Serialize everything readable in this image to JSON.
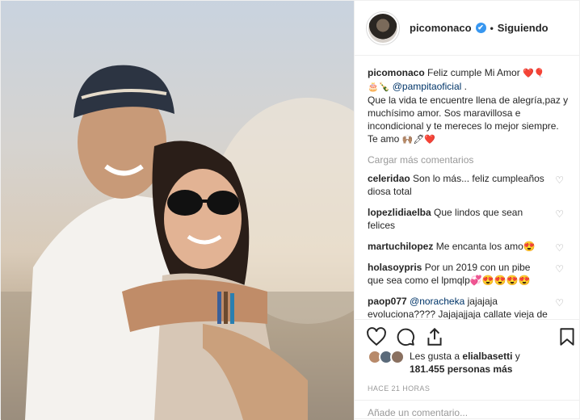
{
  "header": {
    "username": "picomonaco",
    "verified_mark": "✔",
    "separator": "•",
    "follow_label": "Siguiendo"
  },
  "caption": {
    "username": "picomonaco",
    "text_1": "Feliz cumple Mi Amor",
    "emoji_1": "❤️🎈",
    "emoji_2": "🎂🍾",
    "mention": "@pampitaoficial",
    "text_2": ".",
    "text_3": "Que la vida te encuentre llena de alegría,paz y muchísimo amor. Sos maravillosa e incondicional y te mereces lo mejor siempre. Te amo",
    "emoji_3": "🙌🏽🖊❤️"
  },
  "load_more": "Cargar más comentarios",
  "comments": [
    {
      "user": "celeridao",
      "text": "Son lo más... feliz cumpleaños diosa total"
    },
    {
      "user": "lopezlidiaelba",
      "text": "Que lindos que sean felices"
    },
    {
      "user": "martuchilopez",
      "text": "Me encanta los amo😍"
    },
    {
      "user": "holasoypris",
      "text": "Por un 2019 con un pibe que sea como el lpmqlp💞😍😍😍😍"
    },
    {
      "user": "paop077",
      "mention": "@noracheka",
      "text": "jajajaja evoluciona???? Jajajajjaja callate vieja de mierda"
    }
  ],
  "likes": {
    "prefix": "Les gusta a",
    "user": "elialbasetti",
    "joiner": "y",
    "count": "181.455 personas más"
  },
  "timestamp": "HACE 21 HORAS",
  "add_comment_placeholder": "Añade un comentario...",
  "colors": {
    "accent": "#3897f0",
    "mention": "#003569",
    "muted": "#999999",
    "heart": "#ed4956"
  },
  "icons": [
    "heart-icon",
    "comment-icon",
    "share-icon",
    "bookmark-icon",
    "verified-icon"
  ]
}
